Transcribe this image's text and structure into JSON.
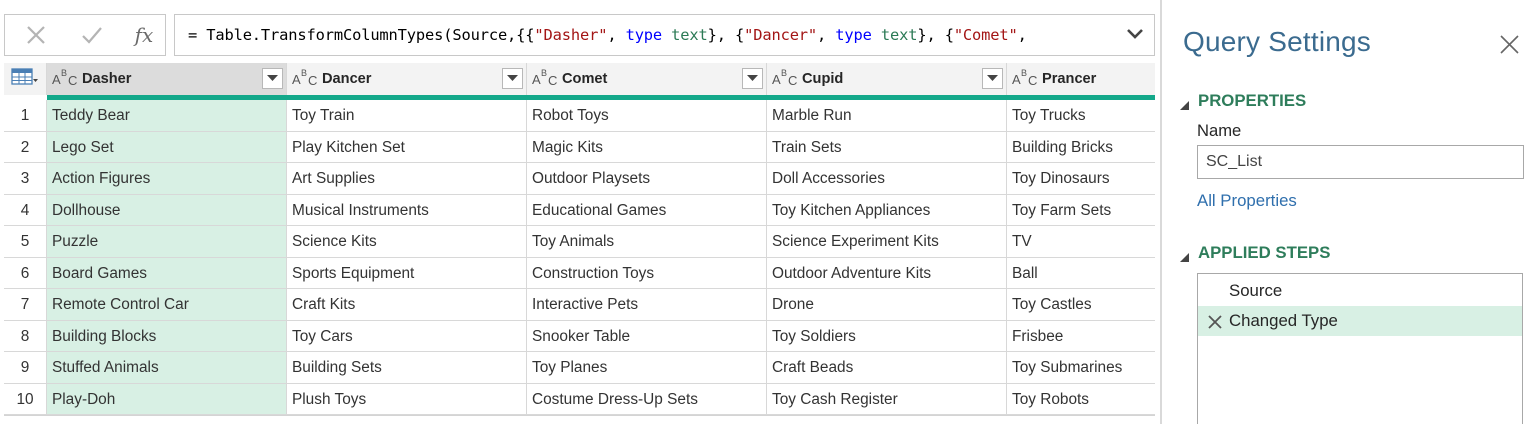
{
  "formula_bar": {
    "cancel_icon": "x-icon",
    "commit_icon": "check-icon",
    "fx_label": "fx",
    "formula_segments": [
      {
        "text": "= Table.TransformColumnTypes(Source,{{",
        "style": "plain"
      },
      {
        "text": "\"Dasher\"",
        "style": "str"
      },
      {
        "text": ", ",
        "style": "plain"
      },
      {
        "text": "type",
        "style": "kw"
      },
      {
        "text": " ",
        "style": "plain"
      },
      {
        "text": "text",
        "style": "type"
      },
      {
        "text": "}, {",
        "style": "plain"
      },
      {
        "text": "\"Dancer\"",
        "style": "str"
      },
      {
        "text": ", ",
        "style": "plain"
      },
      {
        "text": "type",
        "style": "kw"
      },
      {
        "text": " ",
        "style": "plain"
      },
      {
        "text": "text",
        "style": "type"
      },
      {
        "text": "}, {",
        "style": "plain"
      },
      {
        "text": "\"Comet\"",
        "style": "str"
      },
      {
        "text": ",",
        "style": "plain"
      }
    ],
    "expand_icon": "chevron-down-icon"
  },
  "grid": {
    "type_label_A": "A",
    "type_label_B": "B",
    "type_label_C": "C",
    "selected_column": "Dasher",
    "columns": [
      "Dasher",
      "Dancer",
      "Comet",
      "Cupid",
      "Prancer"
    ],
    "rows": [
      {
        "n": "1",
        "cells": [
          "Teddy Bear",
          "Toy Train",
          "Robot Toys",
          "Marble Run",
          "Toy Trucks"
        ]
      },
      {
        "n": "2",
        "cells": [
          "Lego Set",
          "Play Kitchen Set",
          "Magic Kits",
          "Train Sets",
          "Building Bricks"
        ]
      },
      {
        "n": "3",
        "cells": [
          "Action Figures",
          "Art Supplies",
          "Outdoor Playsets",
          "Doll Accessories",
          "Toy Dinosaurs"
        ]
      },
      {
        "n": "4",
        "cells": [
          "Dollhouse",
          "Musical Instruments",
          "Educational Games",
          "Toy Kitchen Appliances",
          "Toy Farm Sets"
        ]
      },
      {
        "n": "5",
        "cells": [
          "Puzzle",
          "Science Kits",
          "Toy Animals",
          "Science Experiment Kits",
          "TV"
        ]
      },
      {
        "n": "6",
        "cells": [
          "Board Games",
          "Sports Equipment",
          "Construction Toys",
          "Outdoor Adventure Kits",
          "Ball"
        ]
      },
      {
        "n": "7",
        "cells": [
          "Remote Control Car",
          "Craft Kits",
          "Interactive Pets",
          "Drone",
          "Toy Castles"
        ]
      },
      {
        "n": "8",
        "cells": [
          "Building Blocks",
          "Toy Cars",
          "Snooker Table",
          "Toy Soldiers",
          "Frisbee"
        ]
      },
      {
        "n": "9",
        "cells": [
          "Stuffed Animals",
          "Building Sets",
          "Toy Planes",
          "Craft Beads",
          "Toy Submarines"
        ]
      },
      {
        "n": "10",
        "cells": [
          "Play-Doh",
          "Plush Toys",
          "Costume Dress-Up Sets",
          "Toy Cash Register",
          "Toy Robots"
        ]
      }
    ]
  },
  "query_settings": {
    "title": "Query Settings",
    "close_icon": "close-icon",
    "properties_heading": "PROPERTIES",
    "name_label": "Name",
    "name_value": "SC_List",
    "all_properties_link": "All Properties",
    "applied_steps_heading": "APPLIED STEPS",
    "steps": [
      {
        "label": "Source",
        "active": false
      },
      {
        "label": "Changed Type",
        "active": true
      }
    ]
  },
  "colors": {
    "accent_title": "#3b6b8f",
    "section_heading": "#2e7d5b",
    "link": "#2f6fad",
    "quality_bar": "#13a88a",
    "selected_fill": "#d8f0e4"
  }
}
